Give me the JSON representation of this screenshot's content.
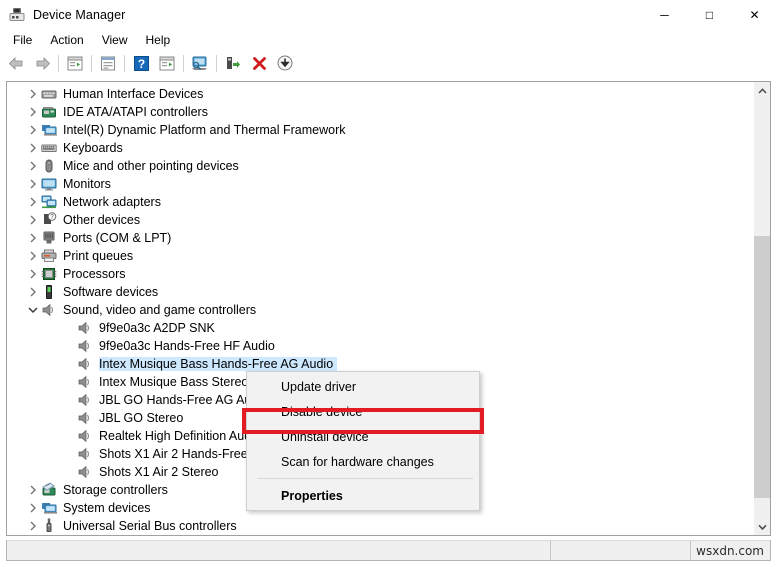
{
  "window": {
    "title": "Device Manager",
    "icon": "device-manager-icon",
    "buttons": {
      "minimize": "─",
      "maximize": "□",
      "close": "✕"
    }
  },
  "menubar": {
    "items": [
      {
        "label": "File",
        "name": "menu-file"
      },
      {
        "label": "Action",
        "name": "menu-action"
      },
      {
        "label": "View",
        "name": "menu-view"
      },
      {
        "label": "Help",
        "name": "menu-help"
      }
    ]
  },
  "toolbar": {
    "buttons": [
      {
        "name": "back-button",
        "icon": "back-arrow-icon"
      },
      {
        "name": "forward-button",
        "icon": "forward-arrow-icon"
      },
      {
        "name": "show-hide-console-tree-button",
        "icon": "console-tree-icon"
      },
      {
        "name": "properties-button",
        "icon": "properties-window-icon"
      },
      {
        "name": "help-button",
        "icon": "question-mark-icon"
      },
      {
        "name": "show-hide-action-pane-button",
        "icon": "action-pane-icon"
      },
      {
        "name": "scan-for-hardware-changes-button",
        "icon": "monitor-scan-icon"
      },
      {
        "name": "update-driver-button",
        "icon": "update-driver-icon"
      },
      {
        "name": "uninstall-device-button",
        "icon": "red-x-icon"
      },
      {
        "name": "disable-device-button",
        "icon": "down-arrow-circle-icon"
      }
    ]
  },
  "tree": {
    "nodes": [
      {
        "label": "Human Interface Devices",
        "level": 1,
        "state": "collapsed",
        "icon": "hid-icon"
      },
      {
        "label": "IDE ATA/ATAPI controllers",
        "level": 1,
        "state": "collapsed",
        "icon": "ide-controller-icon"
      },
      {
        "label": "Intel(R) Dynamic Platform and Thermal Framework",
        "level": 1,
        "state": "collapsed",
        "icon": "system-device-icon"
      },
      {
        "label": "Keyboards",
        "level": 1,
        "state": "collapsed",
        "icon": "keyboard-icon"
      },
      {
        "label": "Mice and other pointing devices",
        "level": 1,
        "state": "collapsed",
        "icon": "mouse-icon"
      },
      {
        "label": "Monitors",
        "level": 1,
        "state": "collapsed",
        "icon": "monitor-icon"
      },
      {
        "label": "Network adapters",
        "level": 1,
        "state": "collapsed",
        "icon": "network-adapter-icon"
      },
      {
        "label": "Other devices",
        "level": 1,
        "state": "collapsed",
        "icon": "other-device-icon"
      },
      {
        "label": "Ports (COM & LPT)",
        "level": 1,
        "state": "collapsed",
        "icon": "port-icon"
      },
      {
        "label": "Print queues",
        "level": 1,
        "state": "collapsed",
        "icon": "printer-icon"
      },
      {
        "label": "Processors",
        "level": 1,
        "state": "collapsed",
        "icon": "processor-icon"
      },
      {
        "label": "Software devices",
        "level": 1,
        "state": "collapsed",
        "icon": "software-device-icon"
      },
      {
        "label": "Sound, video and game controllers",
        "level": 1,
        "state": "expanded",
        "icon": "speaker-icon"
      },
      {
        "label": "9f9e0a3c A2DP SNK",
        "level": 2,
        "state": "leaf",
        "icon": "speaker-icon"
      },
      {
        "label": "9f9e0a3c Hands-Free HF Audio",
        "level": 2,
        "state": "leaf",
        "icon": "speaker-icon"
      },
      {
        "label": "Intex Musique Bass Hands-Free AG Audio",
        "level": 2,
        "state": "leaf",
        "icon": "speaker-icon",
        "selected": true
      },
      {
        "label": "Intex Musique Bass Stereo",
        "level": 2,
        "state": "leaf",
        "icon": "speaker-icon"
      },
      {
        "label": "JBL GO Hands-Free AG Audio",
        "level": 2,
        "state": "leaf",
        "icon": "speaker-icon"
      },
      {
        "label": "JBL GO Stereo",
        "level": 2,
        "state": "leaf",
        "icon": "speaker-icon"
      },
      {
        "label": "Realtek High Definition Audio",
        "level": 2,
        "state": "leaf",
        "icon": "speaker-icon"
      },
      {
        "label": "Shots X1 Air 2 Hands-Free AG Audio",
        "level": 2,
        "state": "leaf",
        "icon": "speaker-icon"
      },
      {
        "label": "Shots X1 Air 2 Stereo",
        "level": 2,
        "state": "leaf",
        "icon": "speaker-icon"
      },
      {
        "label": "Storage controllers",
        "level": 1,
        "state": "collapsed",
        "icon": "storage-controller-icon"
      },
      {
        "label": "System devices",
        "level": 1,
        "state": "collapsed",
        "icon": "system-device-icon"
      },
      {
        "label": "Universal Serial Bus controllers",
        "level": 1,
        "state": "collapsed",
        "icon": "usb-controller-icon"
      }
    ]
  },
  "context_menu": {
    "items": [
      {
        "label": "Update driver",
        "name": "ctx-update-driver",
        "bold": false,
        "separator_after": false
      },
      {
        "label": "Disable device",
        "name": "ctx-disable-device",
        "bold": false,
        "separator_after": false
      },
      {
        "label": "Uninstall device",
        "name": "ctx-uninstall-device",
        "bold": false,
        "separator_after": true,
        "highlighted": true
      },
      {
        "label": "Scan for hardware changes",
        "name": "ctx-scan-hardware-changes",
        "bold": false,
        "separator_after": true
      },
      {
        "label": "Properties",
        "name": "ctx-properties",
        "bold": true,
        "separator_after": false
      }
    ],
    "highlight_color": "#e31c23"
  },
  "statusbar": {
    "cell1": "",
    "cell2": "",
    "watermark": "wsxdn.com"
  }
}
